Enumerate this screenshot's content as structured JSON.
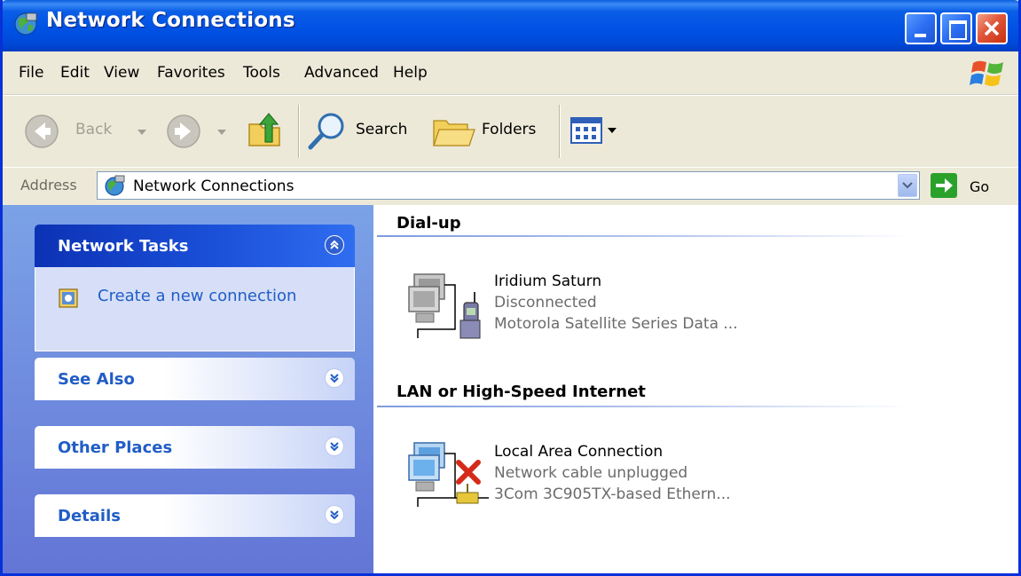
{
  "window": {
    "title": "Network Connections"
  },
  "menu": {
    "items": [
      "File",
      "Edit",
      "View",
      "Favorites",
      "Tools",
      "Advanced",
      "Help"
    ]
  },
  "toolbar": {
    "back_label": "Back",
    "search_label": "Search",
    "folders_label": "Folders"
  },
  "address": {
    "label": "Address",
    "value": "Network Connections",
    "go_label": "Go"
  },
  "taskpane": {
    "network_tasks": {
      "title": "Network Tasks",
      "items": [
        "Create a new connection"
      ]
    },
    "see_also": {
      "title": "See Also"
    },
    "other_places": {
      "title": "Other Places"
    },
    "details": {
      "title": "Details"
    }
  },
  "groups": [
    {
      "title": "Dial-up",
      "connections": [
        {
          "name": "Iridium Saturn",
          "status": "Disconnected",
          "device": "Motorola Satellite Series Data ...",
          "icon": "dialup-connection-icon"
        }
      ]
    },
    {
      "title": "LAN or High-Speed Internet",
      "connections": [
        {
          "name": "Local Area Connection",
          "status": "Network cable unplugged",
          "device": "3Com 3C905TX-based Ethern...",
          "icon": "lan-connection-disconnected-icon"
        }
      ]
    }
  ],
  "colors": {
    "titlebar": "#0052e4",
    "taskpane": "#6f8fdc",
    "link": "#215dc6"
  }
}
